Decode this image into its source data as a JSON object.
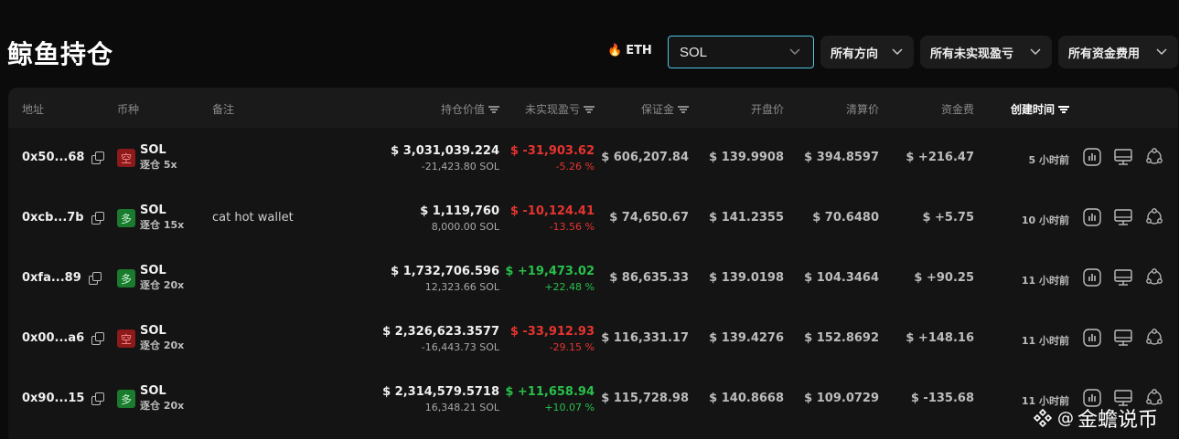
{
  "header": {
    "title": "鲸鱼持仓",
    "eth_tag": "ETH",
    "coin_select": "SOL",
    "filters": [
      "所有方向",
      "所有未实现盈亏",
      "所有资金费用"
    ]
  },
  "table": {
    "columns": {
      "address": "地址",
      "coin": "币种",
      "note": "备注",
      "value": "持仓价值",
      "pnl": "未实现盈亏",
      "margin": "保证金",
      "open_price": "开盘价",
      "liq_price": "清算价",
      "funding": "资金费",
      "created": "创建时间"
    },
    "rows": [
      {
        "address": "0x50...68",
        "side": "空",
        "side_type": "short",
        "symbol": "SOL",
        "leverage": "逐仓 5x",
        "note": "",
        "value": "$ 3,031,039.224",
        "size": "-21,423.80 SOL",
        "pnl": "$ -31,903.62",
        "pnl_pct": "-5.26 %",
        "pnl_type": "neg",
        "margin": "$ 606,207.84",
        "open_price": "$ 139.9908",
        "liq_price": "$ 394.8597",
        "funding": "$ +216.47",
        "funding_type": "pos",
        "time": "5 小时前"
      },
      {
        "address": "0xcb...7b",
        "side": "多",
        "side_type": "long",
        "symbol": "SOL",
        "leverage": "逐仓 15x",
        "note": "cat hot wallet",
        "value": "$ 1,119,760",
        "size": "8,000.00 SOL",
        "pnl": "$ -10,124.41",
        "pnl_pct": "-13.56 %",
        "pnl_type": "neg",
        "margin": "$ 74,650.67",
        "open_price": "$ 141.2355",
        "liq_price": "$ 70.6480",
        "funding": "$ +5.75",
        "funding_type": "pos",
        "time": "10 小时前"
      },
      {
        "address": "0xfa...89",
        "side": "多",
        "side_type": "long",
        "symbol": "SOL",
        "leverage": "逐仓 20x",
        "note": "",
        "value": "$ 1,732,706.596",
        "size": "12,323.66 SOL",
        "pnl": "$ +19,473.02",
        "pnl_pct": "+22.48 %",
        "pnl_type": "pos",
        "margin": "$ 86,635.33",
        "open_price": "$ 139.0198",
        "liq_price": "$ 104.3464",
        "funding": "$ +90.25",
        "funding_type": "pos",
        "time": "11 小时前"
      },
      {
        "address": "0x00...a6",
        "side": "空",
        "side_type": "short",
        "symbol": "SOL",
        "leverage": "逐仓 20x",
        "note": "",
        "value": "$ 2,326,623.3577",
        "size": "-16,443.73 SOL",
        "pnl": "$ -33,912.93",
        "pnl_pct": "-29.15 %",
        "pnl_type": "neg",
        "margin": "$ 116,331.17",
        "open_price": "$ 139.4276",
        "liq_price": "$ 152.8692",
        "funding": "$ +148.16",
        "funding_type": "pos",
        "time": "11 小时前"
      },
      {
        "address": "0x90...15",
        "side": "多",
        "side_type": "long",
        "symbol": "SOL",
        "leverage": "逐仓 20x",
        "note": "",
        "value": "$ 2,314,579.5718",
        "size": "16,348.21 SOL",
        "pnl": "$ +11,658.94",
        "pnl_pct": "+10.07 %",
        "pnl_type": "pos",
        "margin": "$ 115,728.98",
        "open_price": "$ 140.8668",
        "liq_price": "$ 109.0729",
        "funding": "$ -135.68",
        "funding_type": "neg",
        "time": "11 小时前"
      }
    ]
  },
  "watermark": {
    "at": "@",
    "text": "金蟾说币"
  },
  "colors": {
    "accent": "#4fc3e0",
    "positive": "#27c04a",
    "negative": "#e5342f",
    "short_badge": "#8c1a1a",
    "long_badge": "#1a7a2e"
  }
}
